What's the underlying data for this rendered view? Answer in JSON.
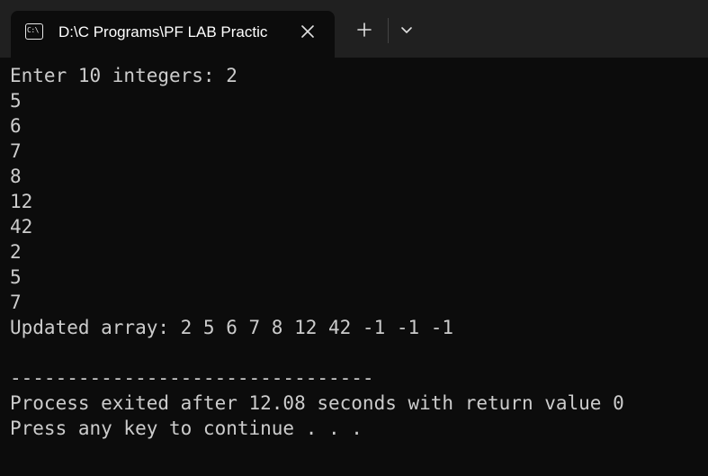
{
  "tab": {
    "icon": "terminal-icon",
    "icon_text": "C:\\",
    "title": "D:\\C Programs\\PF LAB Practic",
    "close_icon": "close-icon"
  },
  "toolbar": {
    "new_tab_icon": "plus-icon",
    "dropdown_icon": "chevron-down-icon"
  },
  "console": {
    "lines": [
      "Enter 10 integers: 2",
      "5",
      "6",
      "7",
      "8",
      "12",
      "42",
      "2",
      "5",
      "7",
      "Updated array: 2 5 6 7 8 12 42 -1 -1 -1",
      "",
      "--------------------------------",
      "Process exited after 12.08 seconds with return value 0",
      "Press any key to continue . . ."
    ]
  },
  "colors": {
    "background": "#0c0c0c",
    "titlebar": "#202020",
    "text": "#cccccc"
  }
}
